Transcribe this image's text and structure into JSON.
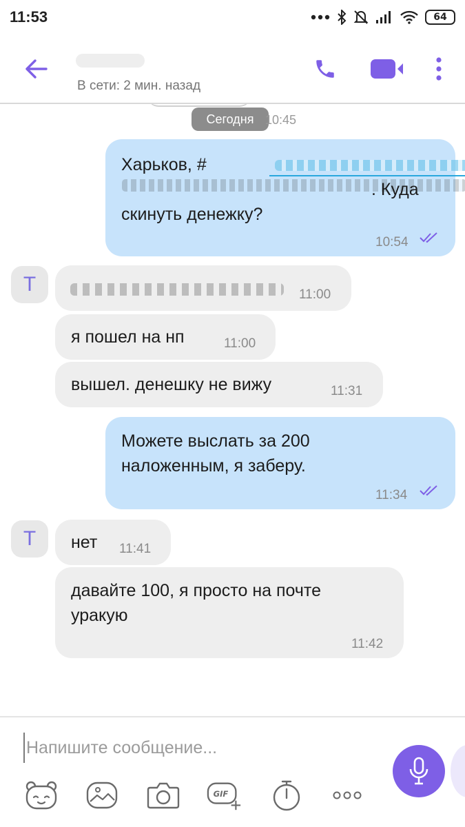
{
  "status_bar": {
    "time": "11:53",
    "battery": "64",
    "icons": [
      "dots-icon",
      "bluetooth-icon",
      "mute-icon",
      "signal-icon",
      "wifi-icon",
      "battery-icon"
    ]
  },
  "header": {
    "status": "В сети: 2 мин. назад",
    "icons": [
      "back-arrow-icon",
      "phone-icon",
      "video-camera-icon",
      "more-vert-icon"
    ],
    "accent": "#7e5fe6"
  },
  "chat": {
    "date_label": "Сегодня",
    "date_time": "10:45",
    "avatar_letter": "T",
    "messages": [
      {
        "direction": "out",
        "line1_a": "Харьков, ",
        "line1_b": "#",
        "line2_tail": ". Куда",
        "line3": "скинуть денежку?",
        "time": "10:54",
        "status": "read"
      },
      {
        "direction": "in",
        "text": "",
        "time": "11:00"
      },
      {
        "direction": "in",
        "text": "я пошел на нп",
        "time": "11:00"
      },
      {
        "direction": "in",
        "text": "вышел. денешку не вижу",
        "time": "11:31"
      },
      {
        "direction": "out",
        "line1": "Можете выслать за 200",
        "line2": "наложенным, я заберу.",
        "time": "11:34",
        "status": "read"
      },
      {
        "direction": "in",
        "text": "нет",
        "time": "11:41"
      },
      {
        "direction": "in",
        "line1": "давайте 100, я просто на почте",
        "line2": "уракую",
        "time": "11:42"
      }
    ],
    "colors": {
      "outgoing": "#c7e3fb",
      "incoming": "#eeeeee",
      "ticks": "#7e5fe6"
    }
  },
  "composer": {
    "placeholder": "Напишите сообщение...",
    "gif": "GIF",
    "icons": [
      "sticker-icon",
      "gallery-icon",
      "camera-icon",
      "gif-icon",
      "timer-icon",
      "more-icon",
      "microphone-icon"
    ]
  }
}
